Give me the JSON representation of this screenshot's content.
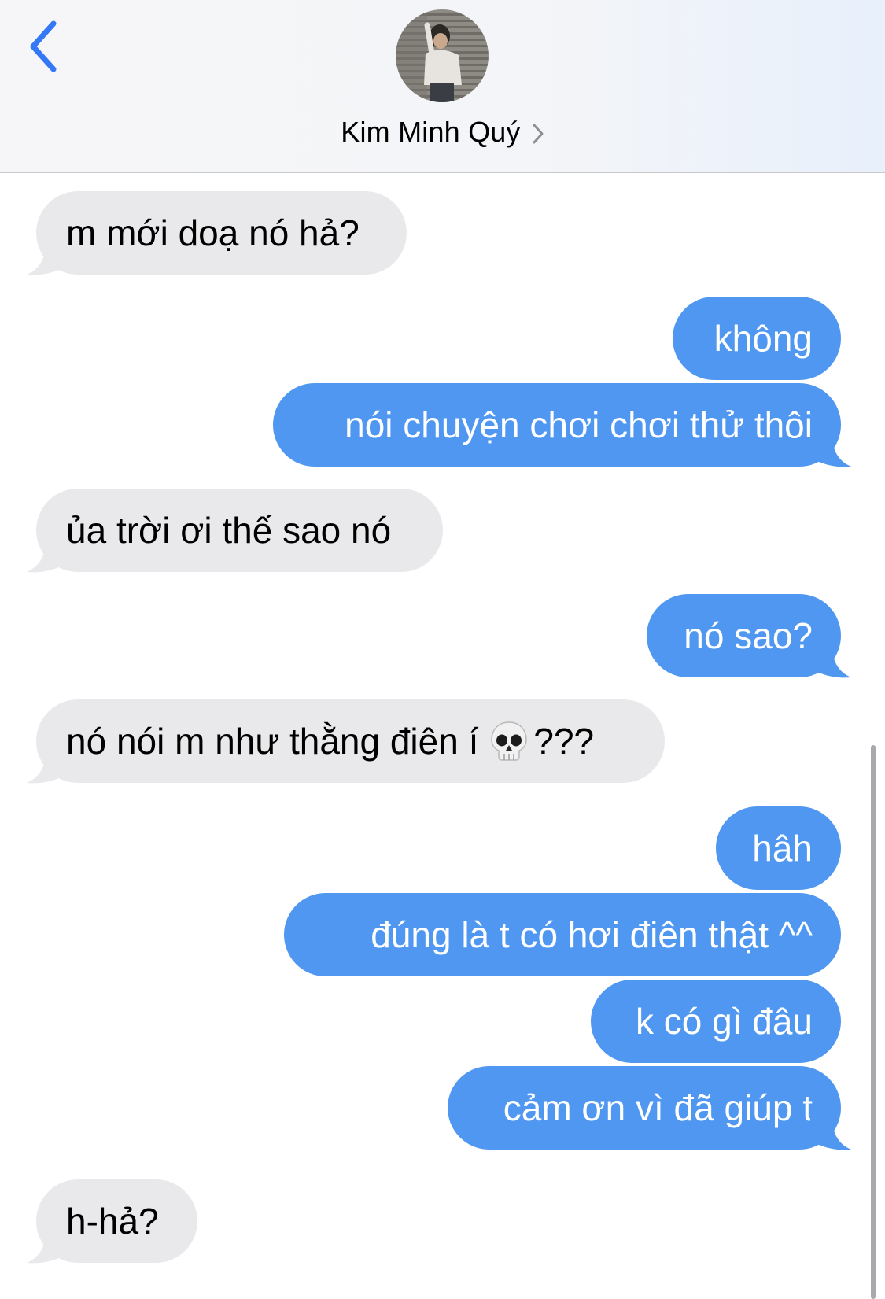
{
  "header": {
    "contact_name": "Kim Minh Quý",
    "back_icon": "chevron-left-icon",
    "disclosure_icon": "chevron-right-icon",
    "accent_color": "#3478f6"
  },
  "messages": [
    {
      "side": "in",
      "text": "m mới doạ nó hả?"
    },
    {
      "side": "out",
      "text": "không"
    },
    {
      "side": "out",
      "text": "nói chuyện chơi chơi thử thôi"
    },
    {
      "side": "in",
      "text": "ủa trời ơi thế sao nó"
    },
    {
      "side": "out",
      "text": "nó sao?"
    },
    {
      "side": "in",
      "text": "nó nói m như thằng điên í",
      "emoji": "skull-emoji",
      "text_after": "???"
    },
    {
      "side": "out",
      "text": "hâh"
    },
    {
      "side": "out",
      "text": "đúng là t có hơi điên thật ^^"
    },
    {
      "side": "out",
      "text": "k có gì đâu"
    },
    {
      "side": "out",
      "text": "cảm ơn vì đã giúp t"
    },
    {
      "side": "in",
      "text": "h-hả?"
    }
  ],
  "colors": {
    "incoming_bubble": "#e9e9eb",
    "outgoing_bubble": "#4f97f0",
    "outgoing_text": "#ffffff"
  }
}
